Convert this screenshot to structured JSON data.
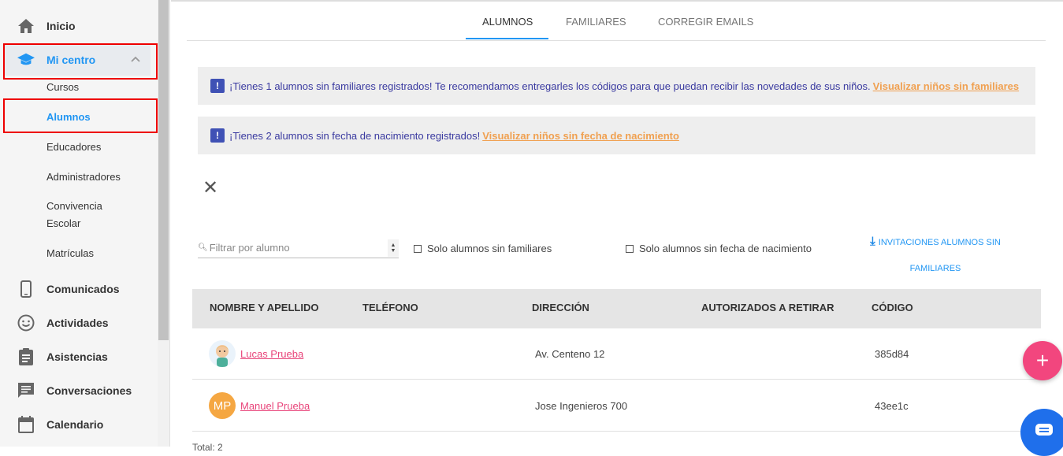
{
  "sidebar": {
    "items": [
      {
        "label": "Inicio",
        "icon": "home-icon"
      },
      {
        "label": "Mi centro",
        "icon": "graduation-cap-icon"
      },
      {
        "label": "Comunicados",
        "icon": "phone-icon"
      },
      {
        "label": "Actividades",
        "icon": "smiley-icon"
      },
      {
        "label": "Asistencias",
        "icon": "clipboard-icon"
      },
      {
        "label": "Conversaciones",
        "icon": "chat-icon"
      },
      {
        "label": "Calendario",
        "icon": "calendar-icon"
      }
    ],
    "sub_items": [
      "Cursos",
      "Alumnos",
      "Educadores",
      "Administradores",
      "Convivencia",
      "Escolar",
      "Matrículas"
    ]
  },
  "tabs": [
    "ALUMNOS",
    "FAMILIARES",
    "CORREGIR EMAILS"
  ],
  "alerts": [
    {
      "text": "¡Tienes 1 alumnos sin familiares registrados! Te recomendamos entregarles los códigos para que puedan recibir las novedades de sus niños.",
      "link": "Visualizar niños sin familiares"
    },
    {
      "text": "¡Tienes 2 alumnos sin fecha de nacimiento registrados!",
      "link": "Visualizar niños sin fecha de nacimiento"
    }
  ],
  "filter": {
    "placeholder": "Filtrar por alumno"
  },
  "checkboxes": [
    "Solo alumnos sin familiares",
    "Solo alumnos sin fecha de nacimiento"
  ],
  "invite": {
    "line1": "INVITACIONES ALUMNOS SIN",
    "line2": "FAMILIARES"
  },
  "table": {
    "headers": [
      "NOMBRE Y APELLIDO",
      "TELÉFONO",
      "DIRECCIÓN",
      "AUTORIZADOS A RETIRAR",
      "CÓDIGO"
    ],
    "rows": [
      {
        "name": "Lucas Prueba",
        "phone": "",
        "address": "Av. Centeno 12",
        "authorized": "",
        "code": "385d84"
      },
      {
        "name": "Manuel Prueba",
        "initials": "MP",
        "phone": "",
        "address": "Jose Ingenieros 700",
        "authorized": "",
        "code": "43ee1c"
      }
    ],
    "total": "Total: 2"
  },
  "colors": {
    "accent": "#2196f3",
    "link": "#e8447a",
    "alert_link": "#f0a050",
    "fab": "#f2467e"
  }
}
